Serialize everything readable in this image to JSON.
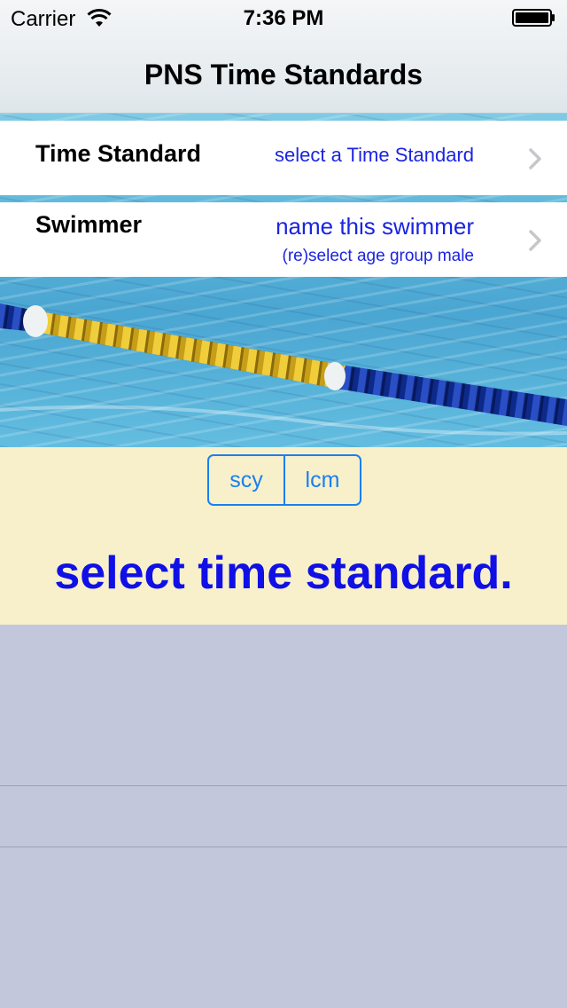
{
  "status_bar": {
    "carrier": "Carrier",
    "time": "7:36 PM"
  },
  "nav": {
    "title": "PNS Time Standards"
  },
  "rows": {
    "time_standard": {
      "label": "Time Standard",
      "value": "select a Time Standard"
    },
    "swimmer": {
      "label": "Swimmer",
      "value": "name this swimmer",
      "subvalue": "(re)select age group male"
    }
  },
  "course_selector": {
    "options": [
      "scy",
      "lcm"
    ]
  },
  "panel": {
    "message": "select time standard."
  },
  "colors": {
    "link_blue": "#1b24e0",
    "accent": "#1a7ff0",
    "panel_bg": "#f8f0ca",
    "background": "#c3c7dc"
  },
  "icons": [
    "wifi-icon",
    "battery-icon",
    "chevron-right-icon",
    "lane-rope-image"
  ]
}
